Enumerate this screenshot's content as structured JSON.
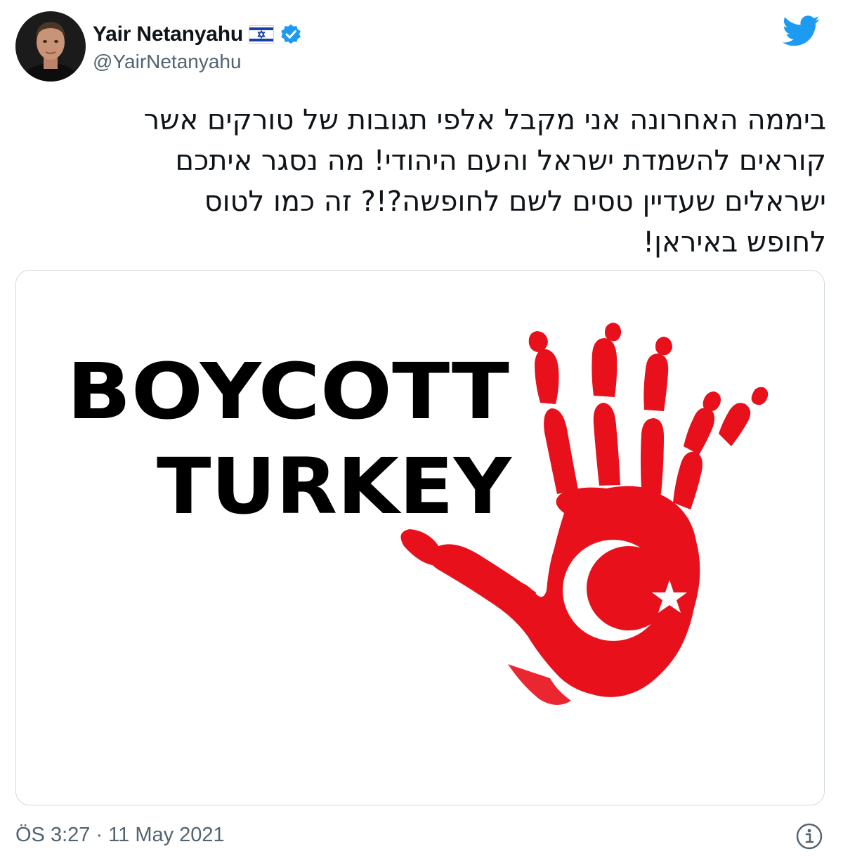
{
  "author": {
    "display_name": "Yair Netanyahu",
    "handle": "@YairNetanyahu",
    "flag_icon": "israel-flag-icon",
    "verified_icon": "verified-badge-icon",
    "avatar_icon": "profile-photo"
  },
  "tweet": {
    "lines": [
      "ביממה האחרונה אני מקבל אלפי תגובות של טורקים אשר",
      "קוראים להשמדת ישראל והעם היהודי! מה נסגר איתכם",
      "ישראלים שעדיין טסים לשם לחופשה?!? זה כמו לטוס",
      "לחופש באיראן!"
    ]
  },
  "media": {
    "line1": "BOYCOTT",
    "line2": "TURKEY",
    "hand_icon": "red-hand-print-with-crescent-and-star"
  },
  "footer": {
    "timestamp": "ÖS 3:27 · 11 May 2021",
    "info_icon": "info-icon"
  },
  "colors": {
    "twitter_blue": "#1d9bf0",
    "verified_blue": "#1d9bf0",
    "muted_text": "#536471",
    "hand_red": "#e8101a",
    "flag_blue": "#1a3fa6"
  }
}
